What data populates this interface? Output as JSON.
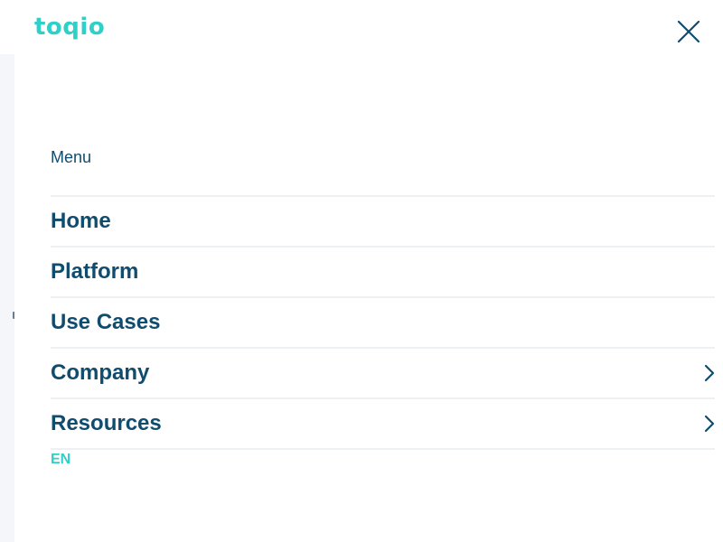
{
  "header": {
    "logo_text": "toqio"
  },
  "menu": {
    "title": "Menu",
    "items": [
      {
        "label": "Home",
        "has_submenu": false
      },
      {
        "label": "Platform",
        "has_submenu": false
      },
      {
        "label": "Use Cases",
        "has_submenu": false
      },
      {
        "label": "Company",
        "has_submenu": true
      },
      {
        "label": "Resources",
        "has_submenu": true
      }
    ],
    "language": "EN"
  },
  "icons": {
    "close": "close-icon",
    "chevron": "chevron-right-icon"
  },
  "colors": {
    "brand": "#2ed0c8",
    "text": "#0f4c6e",
    "divider": "#eef1f4"
  }
}
